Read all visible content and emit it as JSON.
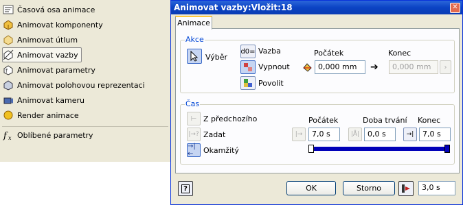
{
  "menu": {
    "items": [
      {
        "label": "Časová osa animace",
        "icon": "timeline-icon"
      },
      {
        "label": "Animovat komponenty",
        "icon": "animate-components-icon"
      },
      {
        "label": "Animovat útlum",
        "icon": "animate-fade-icon"
      },
      {
        "label": "Animovat vazby",
        "icon": "animate-constraints-icon"
      },
      {
        "label": "Animovat parametry",
        "icon": "animate-parameters-icon"
      },
      {
        "label": "Animovat polohovou reprezentaci",
        "icon": "animate-positional-icon"
      },
      {
        "label": "Animovat kameru",
        "icon": "animate-camera-icon"
      },
      {
        "label": "Render animace",
        "icon": "render-animation-icon"
      },
      {
        "label": "Oblíbené parametry",
        "icon": "fx-icon"
      }
    ]
  },
  "dialog": {
    "title": "Animovat vazby:Vložit:18",
    "tab": "Animace",
    "akce": {
      "title": "Akce",
      "vyber": "Výběr",
      "vazba": "Vazba",
      "vazba_icon_text": "d0=",
      "vypnout": "Vypnout",
      "povolit": "Povolit",
      "pocatek_label": "Počátek",
      "pocatek_value": "0,000 mm",
      "konec_label": "Konec",
      "konec_value": "0,000 mm"
    },
    "cas": {
      "title": "Čas",
      "z_predchoziho": "Z předchozího",
      "zadat": "Zadat",
      "okamzity": "Okamžitý",
      "pocatek_label": "Počátek",
      "doba_label": "Doba trvání",
      "konec_label": "Konec",
      "pocatek_value": "7,0 s",
      "doba_value": "0,0 s",
      "konec_value": "7,0 s"
    },
    "footer": {
      "help_icon_text": "?",
      "ok": "OK",
      "storno": "Storno",
      "time_value": "3,0 s"
    }
  }
}
